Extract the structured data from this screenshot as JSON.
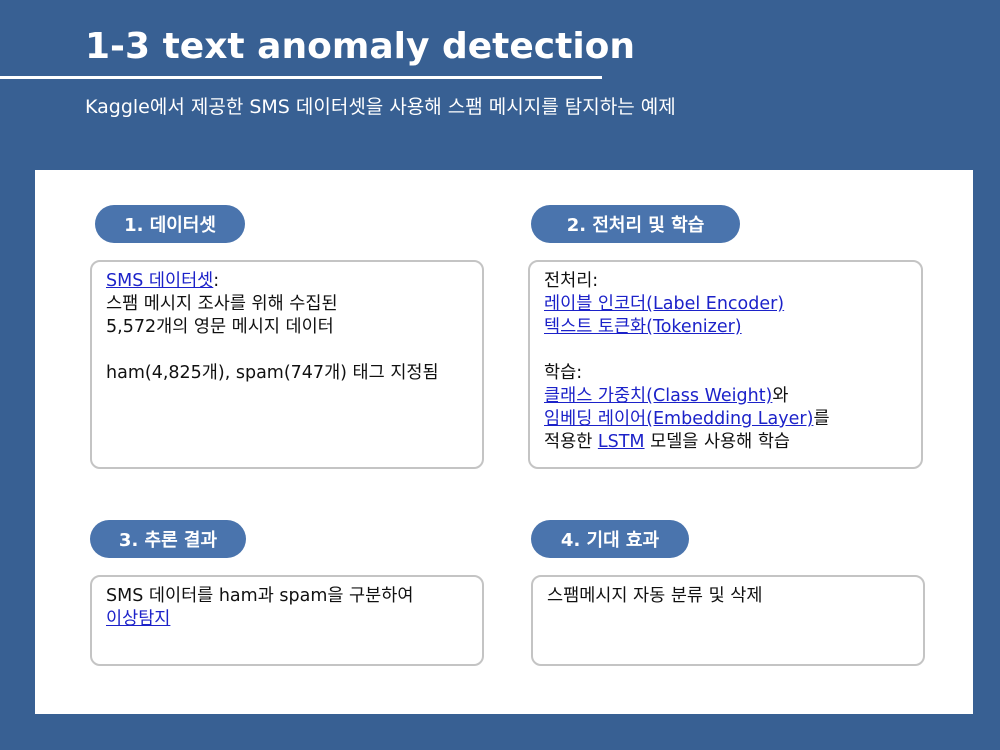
{
  "header": {
    "title": "1-3 text anomaly detection",
    "subtitle": "Kaggle에서 제공한 SMS 데이터셋을 사용해 스팸 메시지를 탐지하는 예제"
  },
  "sections": [
    {
      "label": "1. 데이터셋",
      "lines": [
        [
          "SMS 데이터셋",
          ":"
        ],
        [
          "스팸 메시지 조사를 위해 수집된"
        ],
        [
          "5,572개의 영문 메시지 데이터"
        ],
        [
          ""
        ],
        [
          "ham(4,825개), spam(747개) 태그 지정됨"
        ]
      ]
    },
    {
      "label": "2. 전처리 및 학습",
      "lines": [
        [
          "전처리:"
        ],
        [
          "레이블 인코더(Label Encoder)"
        ],
        [
          "텍스트 토큰화(Tokenizer)"
        ],
        [
          ""
        ],
        [
          "학습:"
        ],
        [
          "클래스 가중치(Class Weight)",
          "와"
        ],
        [
          "임베딩 레이어(Embedding Layer)",
          "를"
        ],
        [
          "적용한 ",
          "LSTM",
          " 모델을 사용해 학습"
        ]
      ]
    },
    {
      "label": "3. 추론 결과",
      "lines": [
        [
          "SMS 데이터를 ham과 spam을 구분하여"
        ],
        [
          "이상탐지"
        ]
      ]
    },
    {
      "label": "4. 기대 효과",
      "lines": [
        [
          "스팸메시지 자동 분류 및 삭제"
        ]
      ]
    }
  ],
  "theme": {
    "background": "#386093",
    "pill": "#4a74ad",
    "link": "#1c22c9"
  }
}
